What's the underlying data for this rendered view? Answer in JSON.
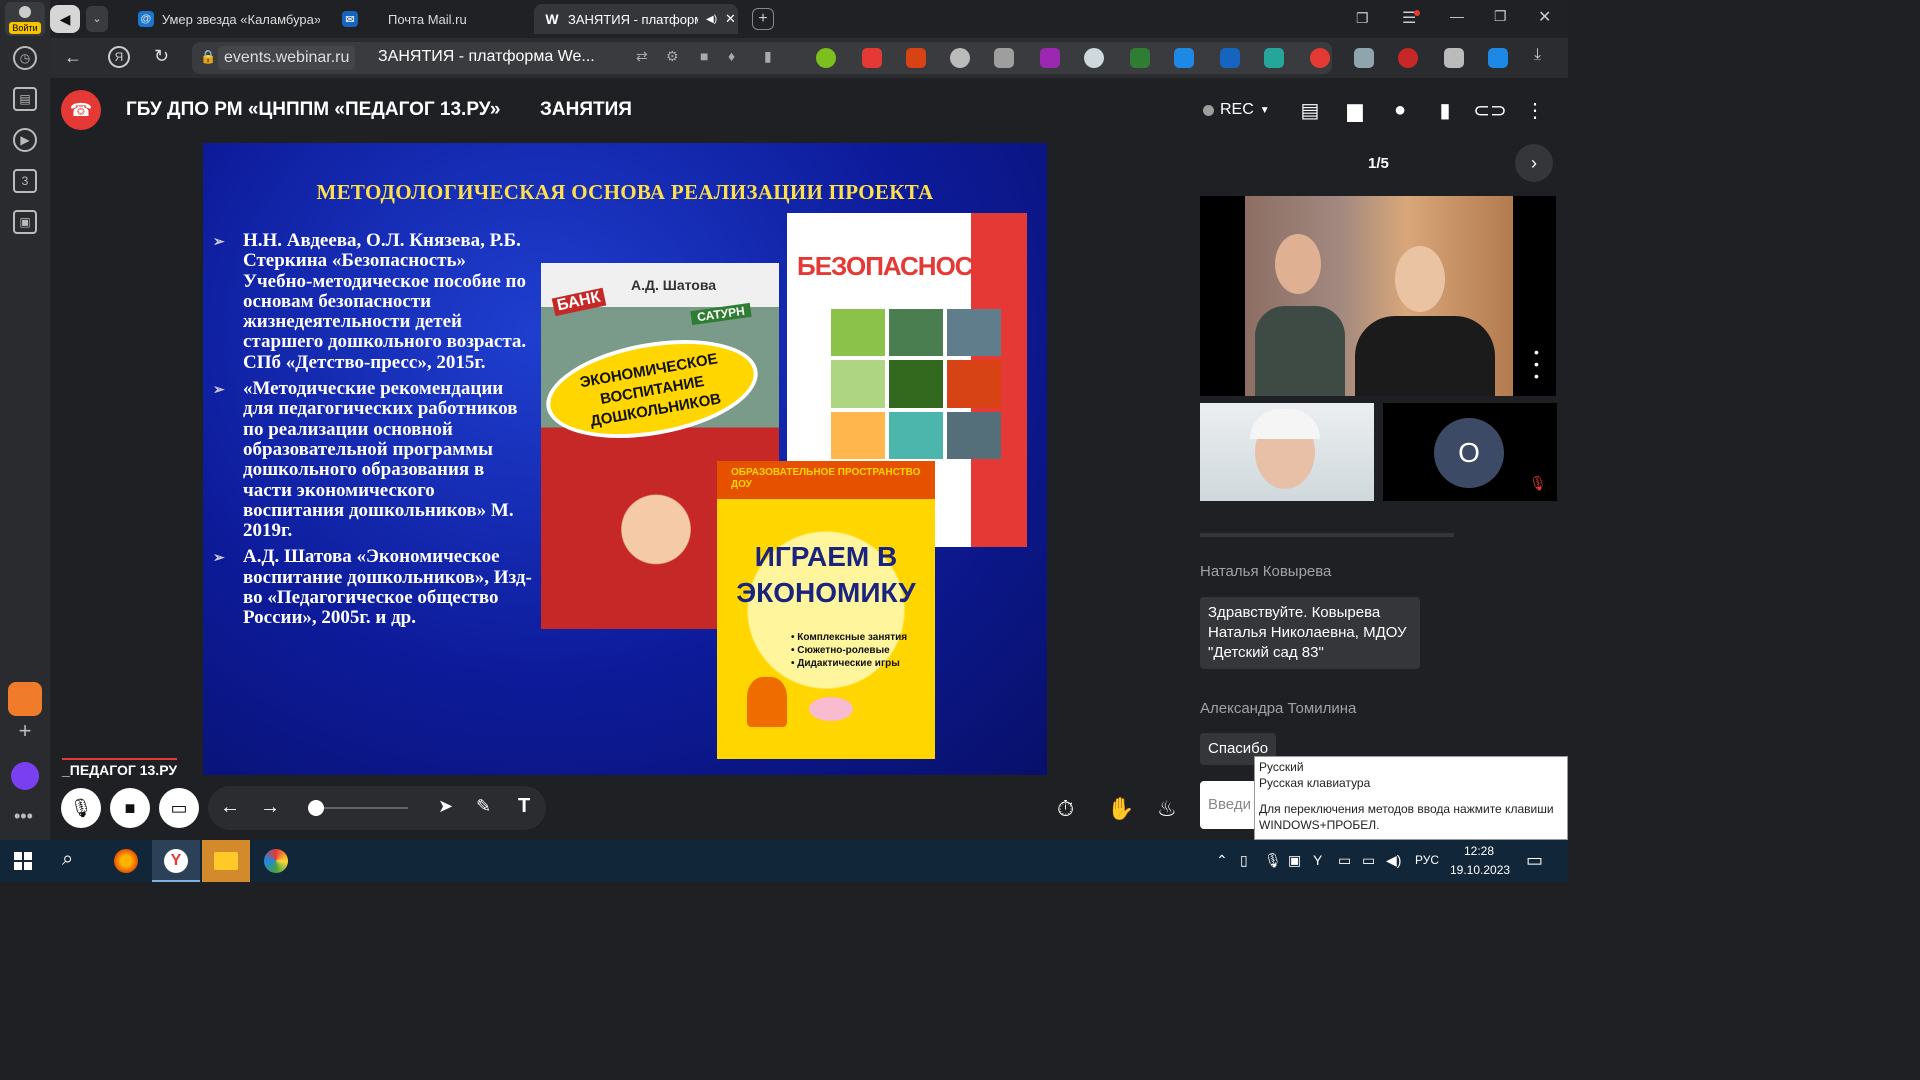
{
  "browser": {
    "login_label": "Войти",
    "tabs": [
      {
        "title": "Умер звезда «Каламбура»"
      },
      {
        "title": "Почта Mail.ru"
      },
      {
        "title": "ЗАНЯТИЯ - платформа Webinar"
      }
    ],
    "url": "events.webinar.ru",
    "page_title": "ЗАНЯТИЯ - платформа We..."
  },
  "sidebar": {
    "badge_number": "3"
  },
  "webinar": {
    "org_title": "ГБУ ДПО РМ «ЦНППМ «ПЕДАГОГ 13.РУ»",
    "event_title": "ЗАНЯТИЯ",
    "rec_label": "REC",
    "slide_counter": "1/5",
    "logo_text": "_ПЕДАГОГ 13.РУ",
    "accent_red": "#e53935"
  },
  "slide": {
    "title": "МЕТОДОЛОГИЧЕСКАЯ ОСНОВА РЕАЛИЗАЦИИ ПРОЕКТА",
    "bullets": [
      "Н.Н. Авдеева, О.Л. Князева, Р.Б. Стеркина «Безопасность» Учебно-методическое пособие по основам безопасности жизнедеятельности детей старшего дошкольного возраста. СПб «Детство-пресс», 2015г.",
      "«Методические рекомендации для педагогических работников по реализации основной образовательной программы дошкольного образования в части экономического воспитания дошкольников» М. 2019г.",
      "А.Д. Шатова «Экономическое воспитание дошкольников», Изд-во «Педагогическое общество России», 2005г. и др."
    ],
    "books": {
      "shatova_author": "А.Д. Шатова",
      "shatova_bank": "БАНК",
      "shatova_saturn": "САТУРН",
      "shatova_title": "ЭКОНОМИЧЕСКОЕ ВОСПИТАНИЕ ДОШКОЛЬНИКОВ",
      "safety_title": "БЕЗОПАСНОСТЬ",
      "econ_header": "ОБРАЗОВАТЕЛЬНОЕ ПРОСТРАНСТВО ДОУ",
      "econ_title": "ИГРАЕМ В ЭКОНОМИКУ",
      "econ_items": [
        "• Комплексные занятия",
        "• Сюжетно-ролевые",
        "• Дидактические игры"
      ]
    }
  },
  "participants": {
    "avatar_letter": "О"
  },
  "chat": {
    "messages": [
      {
        "author": "Наталья Ковырева",
        "text": "Здравствуйте. Ковырева Наталья Николаевна, МДОУ \"Детский сад 83\""
      },
      {
        "author": "Александра Томилина",
        "text": "Спасибо"
      }
    ],
    "input_placeholder": "Введи"
  },
  "ime_tooltip": {
    "line1": "Русский",
    "line2": "Русская клавиатура",
    "line3": "Для переключения методов ввода нажмите клавиши WINDOWS+ПРОБЕЛ."
  },
  "taskbar": {
    "lang": "РУС",
    "time": "12:28",
    "date": "19.10.2023"
  }
}
